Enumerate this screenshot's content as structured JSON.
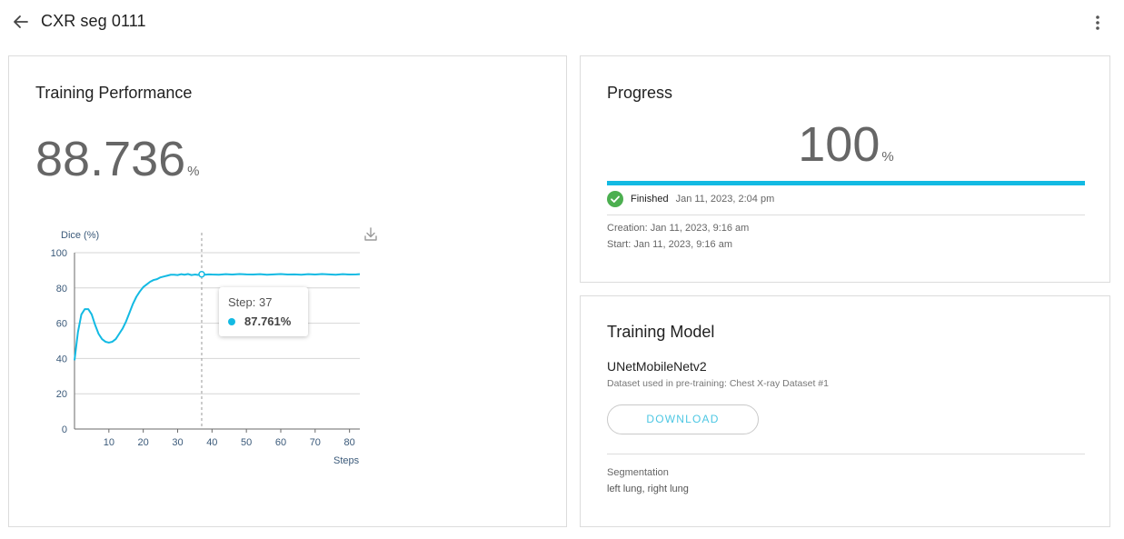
{
  "header": {
    "title": "CXR seg 0111",
    "back_icon": "arrow-back-icon",
    "more_icon": "more-vertical-icon"
  },
  "training_performance": {
    "title": "Training Performance",
    "metric_value": "88.736",
    "metric_unit": "%",
    "download_icon": "download-icon",
    "tooltip": {
      "step_text": "Step: 37",
      "value_text": "87.761%"
    }
  },
  "chart_data": {
    "type": "line",
    "title": "",
    "ylabel": "Dice (%)",
    "xlabel": "Steps",
    "ylim": [
      0,
      100
    ],
    "xlim": [
      0,
      83
    ],
    "yticks": [
      "0",
      "20",
      "40",
      "60",
      "80",
      "100"
    ],
    "xticks": [
      "10",
      "20",
      "30",
      "40",
      "50",
      "60",
      "70",
      "80"
    ],
    "grid": "horizontal",
    "highlight": {
      "x": 37,
      "y": 87.761
    },
    "series": [
      {
        "color": "#13bae3",
        "x": [
          0,
          1,
          2,
          3,
          4,
          5,
          6,
          7,
          8,
          9,
          10,
          11,
          12,
          13,
          14,
          15,
          16,
          17,
          18,
          19,
          20,
          21,
          22,
          23,
          24,
          25,
          26,
          27,
          28,
          29,
          30,
          31,
          32,
          33,
          34,
          35,
          36,
          37,
          38,
          39,
          40,
          42,
          44,
          46,
          48,
          50,
          52,
          54,
          56,
          58,
          60,
          62,
          64,
          66,
          68,
          70,
          72,
          74,
          76,
          78,
          80,
          82,
          83
        ],
        "y": [
          39,
          55,
          65,
          68,
          68,
          65,
          59,
          54,
          51,
          49.5,
          49,
          49.5,
          51,
          54,
          57,
          61,
          66,
          71,
          75,
          78,
          80.5,
          82,
          83.5,
          84.5,
          85,
          86,
          86.5,
          87,
          87.5,
          87.5,
          87.3,
          87.8,
          87.5,
          87.9,
          87.3,
          87.6,
          87.4,
          87.761,
          87.5,
          87.7,
          87.6,
          87.5,
          87.8,
          87.6,
          87.9,
          87.7,
          87.6,
          87.8,
          87.5,
          87.7,
          87.9,
          87.6,
          87.7,
          87.5,
          87.8,
          87.6,
          87.9,
          87.7,
          87.5,
          87.8,
          87.6,
          87.7,
          87.8
        ]
      }
    ]
  },
  "progress": {
    "title": "Progress",
    "value": "100",
    "unit": "%",
    "fraction": 1.0,
    "status_label": "Finished",
    "status_date": "Jan 11, 2023, 2:04 pm",
    "creation": "Creation: Jan 11, 2023, 9:16 am",
    "start": "Start: Jan 11, 2023, 9:16 am",
    "status_color": "#4caf50",
    "accent": "#13bae3"
  },
  "training_model": {
    "title": "Training Model",
    "model_name": "UNetMobileNetv2",
    "dataset_note": "Dataset used in pre-training: Chest X-ray Dataset #1",
    "download_label": "DOWNLOAD",
    "segmentation_label": "Segmentation",
    "segmentation_value": "left lung, right lung"
  }
}
